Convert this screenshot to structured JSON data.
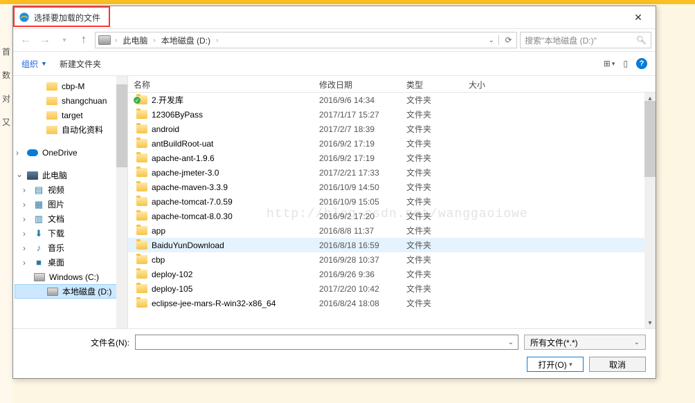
{
  "bg_labels": [
    "首",
    "数",
    "对",
    "",
    "又"
  ],
  "titlebar": {
    "title": "选择要加载的文件"
  },
  "nav": {
    "crumbs": [
      "此电脑",
      "本地磁盘 (D:)"
    ],
    "search_placeholder": "搜索\"本地磁盘 (D:)\""
  },
  "toolbar": {
    "organize": "组织",
    "newfolder": "新建文件夹"
  },
  "sidebar": {
    "top_folders": [
      "cbp-M",
      "shangchuan",
      "target",
      "自动化资料"
    ],
    "onedrive": "OneDrive",
    "this_pc": "此电脑",
    "libs": [
      {
        "label": "视频",
        "glyph": "▤"
      },
      {
        "label": "图片",
        "glyph": "▦"
      },
      {
        "label": "文档",
        "glyph": "▥"
      },
      {
        "label": "下载",
        "glyph": "⬇"
      },
      {
        "label": "音乐",
        "glyph": "♪"
      },
      {
        "label": "桌面",
        "glyph": "■"
      }
    ],
    "drives": [
      {
        "label": "Windows (C:)"
      },
      {
        "label": "本地磁盘 (D:)",
        "selected": true
      }
    ]
  },
  "columns": {
    "name": "名称",
    "date": "修改日期",
    "type": "类型",
    "size": "大小"
  },
  "rows": [
    {
      "name": "2.开发库",
      "date": "2016/9/6 14:34",
      "type": "文件夹",
      "check": true
    },
    {
      "name": "12306ByPass",
      "date": "2017/1/17 15:27",
      "type": "文件夹"
    },
    {
      "name": "android",
      "date": "2017/2/7 18:39",
      "type": "文件夹"
    },
    {
      "name": "antBuildRoot-uat",
      "date": "2016/9/2 17:19",
      "type": "文件夹"
    },
    {
      "name": "apache-ant-1.9.6",
      "date": "2016/9/2 17:19",
      "type": "文件夹"
    },
    {
      "name": "apache-jmeter-3.0",
      "date": "2017/2/21 17:33",
      "type": "文件夹"
    },
    {
      "name": "apache-maven-3.3.9",
      "date": "2016/10/9 14:50",
      "type": "文件夹"
    },
    {
      "name": "apache-tomcat-7.0.59",
      "date": "2016/10/9 15:05",
      "type": "文件夹"
    },
    {
      "name": "apache-tomcat-8.0.30",
      "date": "2016/9/2 17:20",
      "type": "文件夹"
    },
    {
      "name": "app",
      "date": "2016/8/8 11:37",
      "type": "文件夹"
    },
    {
      "name": "BaiduYunDownload",
      "date": "2016/8/18 16:59",
      "type": "文件夹",
      "hover": true
    },
    {
      "name": "cbp",
      "date": "2016/9/28 10:37",
      "type": "文件夹"
    },
    {
      "name": "deploy-102",
      "date": "2016/9/26 9:36",
      "type": "文件夹"
    },
    {
      "name": "deploy-105",
      "date": "2017/2/20 10:42",
      "type": "文件夹"
    },
    {
      "name": "eclipse-jee-mars-R-win32-x86_64",
      "date": "2016/8/24 18:08",
      "type": "文件夹"
    }
  ],
  "watermark": "http://blog.csdn.net/wanggaoiowe",
  "footer": {
    "filename_label": "文件名(N):",
    "type_label": "所有文件(*.*)",
    "open": "打开(O)",
    "cancel": "取消"
  }
}
